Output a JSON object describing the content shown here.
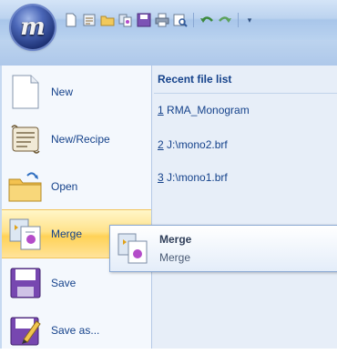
{
  "app": {
    "orb_letter": "m"
  },
  "quick_access": [
    "new-doc-icon",
    "new-recipe-icon",
    "open-folder-icon",
    "merge-icon",
    "save-icon",
    "print-icon",
    "print-preview-icon",
    "undo-icon",
    "redo-icon"
  ],
  "menu": {
    "items": [
      {
        "id": "new",
        "label": "New"
      },
      {
        "id": "new-recipe",
        "label": "New/Recipe"
      },
      {
        "id": "open",
        "label": "Open"
      },
      {
        "id": "merge",
        "label": "Merge"
      },
      {
        "id": "save",
        "label": "Save"
      },
      {
        "id": "save-as",
        "label": "Save as..."
      }
    ],
    "active": "merge"
  },
  "recent": {
    "title": "Recent file list",
    "items": [
      {
        "num": "1",
        "name": " RMA_Monogram"
      },
      {
        "num": "2",
        "name": " J:\\mono2.brf"
      },
      {
        "num": "3",
        "name": " J:\\mono1.brf"
      }
    ]
  },
  "tooltip": {
    "title": "Merge",
    "body": "Merge"
  },
  "colors": {
    "accent": "#15428b",
    "hover": "#ffd257"
  }
}
